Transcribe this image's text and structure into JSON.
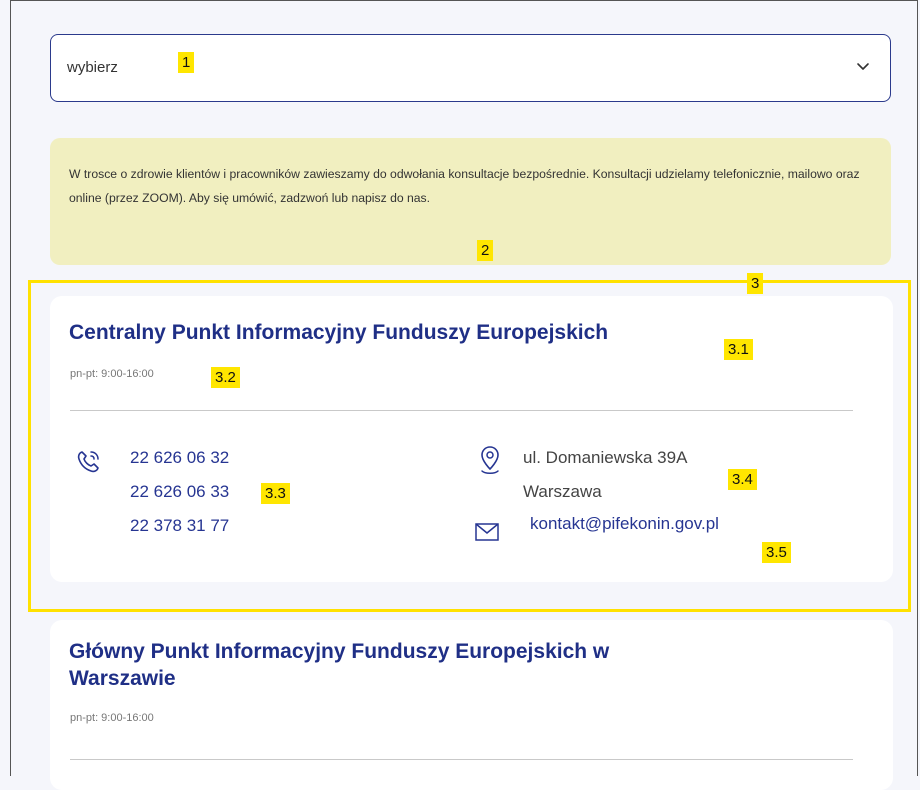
{
  "select": {
    "value": "wybierz",
    "icon": "chevron-down-icon"
  },
  "notice": {
    "text": "W trosce o zdrowie klientów i pracowników zawieszamy do odwołania konsultacje bezpośrednie. Konsultacji udzielamy telefonicznie, mailowo oraz online (przez ZOOM). Aby się umówić, zadzwoń lub napisz do nas."
  },
  "annotations": [
    "1",
    "2",
    "3",
    "3.1",
    "3.2",
    "3.3",
    "3.4",
    "3.5"
  ],
  "cards": [
    {
      "title": "Centralny Punkt Informacyjny Funduszy Europejskich",
      "hours": "pn-pt: 9:00-16:00",
      "phones": [
        "22 626 06 32",
        "22 626 06 33",
        "22 378 31 77"
      ],
      "address": [
        "ul. Domaniewska 39A",
        "Warszawa"
      ],
      "email": "kontakt@pifekonin.gov.pl"
    },
    {
      "title_line1": "Główny Punkt Informacyjny Funduszy Europejskich w",
      "title_line2": "Warszawie",
      "hours": "pn-pt: 9:00-16:00"
    }
  ],
  "colors": {
    "accent": "#1f2f86",
    "highlight": "#ffe600",
    "notice_bg": "#f1efc0"
  }
}
